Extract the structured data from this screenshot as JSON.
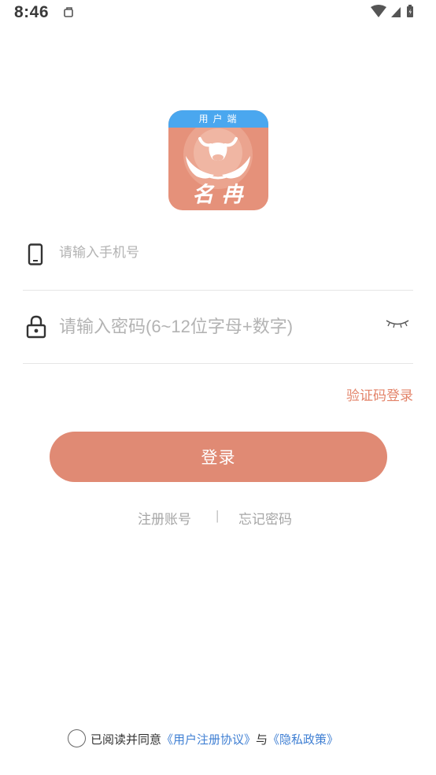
{
  "status_bar": {
    "time": "8:46"
  },
  "app": {
    "badge": "用户端",
    "name": "名冉"
  },
  "login_form": {
    "phone_placeholder": "请输入手机号",
    "password_placeholder": "请输入密码(6~12位字母+数字)",
    "sms_login_label": "验证码登录",
    "login_button_label": "登录"
  },
  "links": {
    "register": "注册账号",
    "divider": "|",
    "forgot_password": "忘记密码"
  },
  "agreement": {
    "prefix": "已阅读并同意",
    "user_agreement": "《用户注册协议》",
    "conjunction": "与",
    "privacy_policy": "《隐私政策》",
    "checked": false
  },
  "colors": {
    "accent": "#e08a74",
    "link": "#3f7fd3",
    "logo_top": "#4aa7ef"
  },
  "icons": [
    "phone-icon",
    "lock-icon",
    "eye-closed-icon",
    "wifi-icon",
    "signal-icon",
    "battery-icon",
    "notification-icon"
  ]
}
